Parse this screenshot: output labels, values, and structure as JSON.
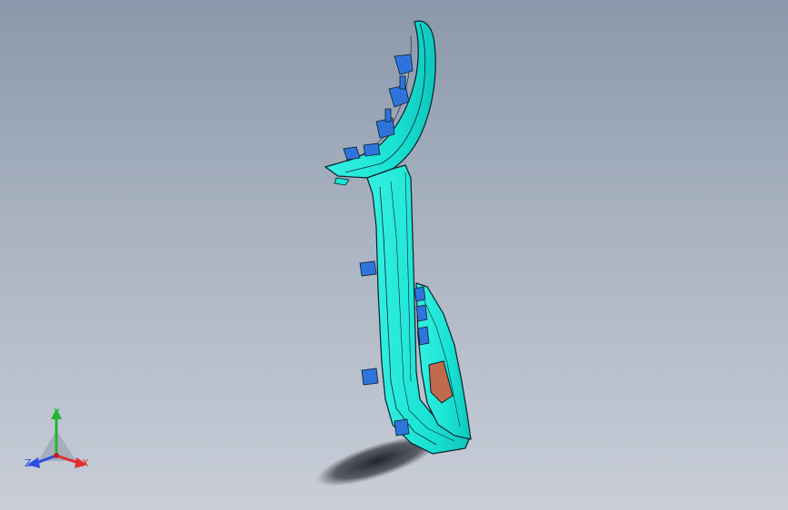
{
  "viewport": {
    "background_top": "#8b98ab",
    "background_bottom": "#c9ced8"
  },
  "model": {
    "body_color": "#19e3d4",
    "clip_color": "#2f74dc",
    "edge_color": "#0a1f2a",
    "pad_color": "#c06a4b"
  },
  "triad": {
    "x_label": "X",
    "y_label": "Y",
    "z_label": "Z",
    "x_color": "#e03030",
    "y_color": "#22b534",
    "z_color": "#2b4fe0"
  }
}
